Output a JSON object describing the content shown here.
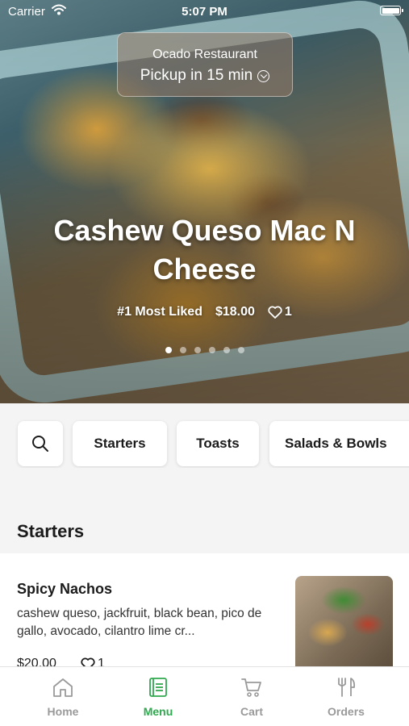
{
  "status_bar": {
    "carrier": "Carrier",
    "time": "5:07 PM"
  },
  "pickup": {
    "restaurant": "Ocado Restaurant",
    "eta": "Pickup in 15 min"
  },
  "featured": {
    "title": "Cashew Queso Mac N Cheese",
    "badge": "#1 Most Liked",
    "price": "$18.00",
    "likes": "1",
    "carousel_pages": 6,
    "carousel_active_index": 0
  },
  "categories": {
    "search_icon": "search-icon",
    "items": [
      "Starters",
      "Toasts",
      "Salads & Bowls"
    ]
  },
  "section": {
    "title": "Starters"
  },
  "menu_items": [
    {
      "name": "Spicy Nachos",
      "description": "cashew queso, jackfruit, black bean, pico de gallo, avocado, cilantro lime cr...",
      "price": "$20.00",
      "likes": "1"
    }
  ],
  "tabbar": {
    "items": [
      {
        "label": "Home",
        "icon": "home-icon",
        "active": false
      },
      {
        "label": "Menu",
        "icon": "menu-book-icon",
        "active": true
      },
      {
        "label": "Cart",
        "icon": "cart-icon",
        "active": false
      },
      {
        "label": "Orders",
        "icon": "utensils-icon",
        "active": false
      }
    ]
  },
  "colors": {
    "accent": "#2eaa4e",
    "inactive_tab": "#9a9a9a"
  }
}
